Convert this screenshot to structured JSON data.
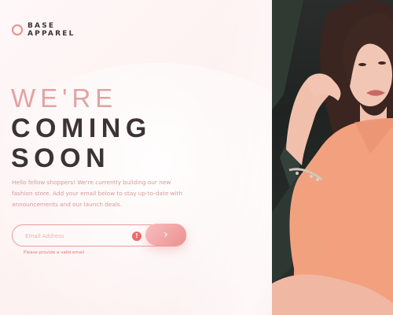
{
  "logo": {
    "line1": "BASE",
    "line2": "APPAREL"
  },
  "heading": {
    "line1": "WE'RE",
    "line2": "COMING",
    "line3": "SOON"
  },
  "description": "Hello fellow shoppers! We're currently building our new fashion store. Add your email below to stay up-to-date with announcements and our launch deals.",
  "form": {
    "email_value": "",
    "email_placeholder": "Email Address",
    "error_icon": "!",
    "error_message": "Please provide a valid email",
    "submit_icon": "chevron-right-icon"
  },
  "colors": {
    "accent": "#ee9a9a",
    "dark_text": "#3b3336",
    "light_heading": "#e3a2a2",
    "error": "#f06b6b"
  }
}
